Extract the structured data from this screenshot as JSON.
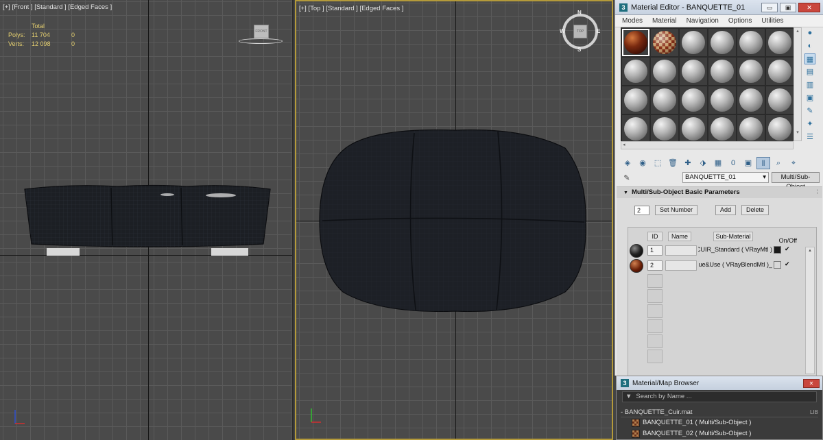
{
  "viewports": {
    "front": {
      "label": "[+] [Front ] [Standard ] [Edged Faces ]",
      "stats": {
        "total_label": "Total",
        "polys_label": "Polys:",
        "polys_total": "11 704",
        "polys_sel": "0",
        "verts_label": "Verts:",
        "verts_total": "12 098",
        "verts_sel": "0"
      }
    },
    "top": {
      "label": "[+] [Top ] [Standard ] [Edged Faces ]",
      "compass": {
        "n": "N",
        "s": "S",
        "e": "E",
        "w": "W",
        "cube": "TOP"
      }
    },
    "front_cube": "FRONT",
    "axis_colors": {
      "x": "#d03030",
      "y": "#30c030",
      "z": "#3050d0"
    }
  },
  "material_editor": {
    "title": "Material Editor - BANQUETTE_01",
    "app_icon": "3",
    "window_buttons": {
      "minimize": "▭",
      "maximize": "▣",
      "close": "✕"
    },
    "menu": [
      "Modes",
      "Material",
      "Navigation",
      "Options",
      "Utilities"
    ],
    "slot_scroll": {
      "left": "◂",
      "up": "▴",
      "down": "▾"
    },
    "side_tools": [
      {
        "icon": "sphere-icon",
        "glyph": "●"
      },
      {
        "icon": "backlight-icon",
        "glyph": "◐"
      },
      {
        "icon": "background-icon",
        "glyph": "▦"
      },
      {
        "icon": "uv-tiling-icon",
        "glyph": "▤"
      },
      {
        "icon": "video-color-icon",
        "glyph": "▥"
      },
      {
        "icon": "preview-icon",
        "glyph": "▣"
      },
      {
        "icon": "options-icon",
        "glyph": "✎"
      },
      {
        "icon": "select-by-material-icon",
        "glyph": "✦"
      },
      {
        "icon": "navigator-icon",
        "glyph": "☰"
      }
    ],
    "toolbar": [
      {
        "icon": "get-material-icon",
        "glyph": "◈"
      },
      {
        "icon": "put-to-scene-icon",
        "glyph": "◉"
      },
      {
        "icon": "assign-material-icon",
        "glyph": "⬚"
      },
      {
        "icon": "reset-icon",
        "glyph": "🗑"
      },
      {
        "icon": "make-copy-icon",
        "glyph": "✚"
      },
      {
        "icon": "make-unique-icon",
        "glyph": "⬗"
      },
      {
        "icon": "put-to-library-icon",
        "glyph": "▦"
      },
      {
        "icon": "material-id-icon",
        "glyph": "0"
      },
      {
        "icon": "show-in-viewport-icon",
        "glyph": "▣"
      },
      {
        "icon": "show-end-result-icon",
        "glyph": "⫴"
      },
      {
        "icon": "go-to-parent-icon",
        "glyph": "⌕"
      },
      {
        "icon": "go-forward-icon",
        "glyph": "⌖"
      }
    ],
    "material_name": "BANQUETTE_01",
    "name_dropdown_arrow": "▾",
    "material_type": "Multi/Sub-Object",
    "eyedropper": "✎",
    "rollout": {
      "title": "Multi/Sub-Object Basic Parameters",
      "collapse_glyph": "▼",
      "pin_glyph": "⁞",
      "count": "2",
      "set_number": "Set Number",
      "add": "Add",
      "delete": "Delete",
      "columns": {
        "id": "ID",
        "name": "Name",
        "sub_material": "Sub-Material",
        "on_off": "On/Off"
      },
      "rows": [
        {
          "id": "1",
          "name": "",
          "sub_material": "CUIR_Standard ( VRayMtl )",
          "swatch": "#1a1a1a",
          "check": "✔"
        },
        {
          "id": "2",
          "name": "",
          "sub_material": "_Laque&Use ( VRayBlendMtl )",
          "swatch": "#d8d8d8",
          "check": "✔"
        }
      ],
      "scroll_up": "▴"
    }
  },
  "browser": {
    "title": "Material/Map Browser",
    "close": "✕",
    "search_arrow": "▼",
    "search_placeholder": "Search by Name ...",
    "library": {
      "name": "- BANQUETTE_Cuir.mat",
      "tag": "LIB"
    },
    "items": [
      "BANQUETTE_01  ( Multi/Sub-Object )",
      "BANQUETTE_02  ( Multi/Sub-Object )"
    ]
  }
}
